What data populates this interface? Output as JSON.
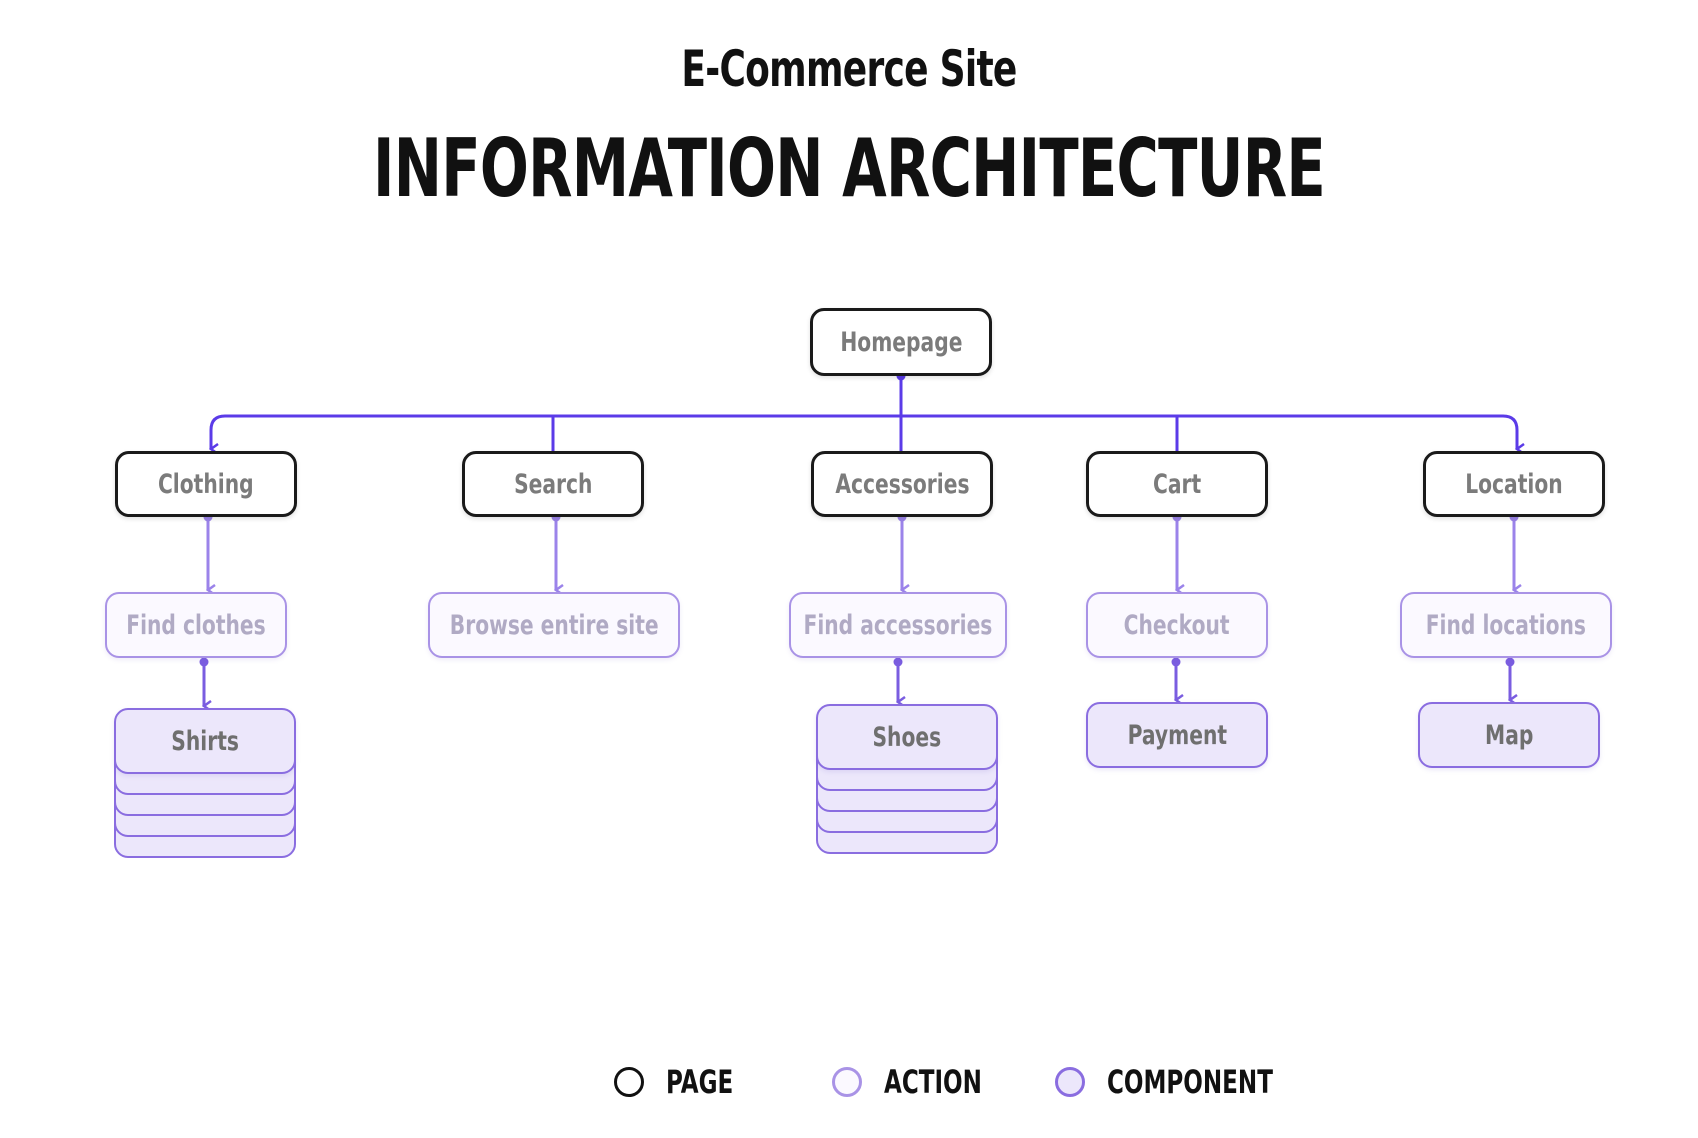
{
  "header": {
    "subtitle": "E-Commerce Site",
    "title": "INFORMATION ARCHITECTURE"
  },
  "colors": {
    "page_border": "#1a1a1a",
    "action_border": "#a993e6",
    "action_fill": "#fbf9ff",
    "component_border": "#8a6de0",
    "component_fill": "#ece7fb",
    "connector_main": "#5b3be8",
    "connector_child": "#9b83ea"
  },
  "root": {
    "label": "Homepage",
    "type": "page"
  },
  "branches": [
    {
      "page": "Clothing",
      "action": "Find clothes",
      "component": "Shirts",
      "component_stacked": true
    },
    {
      "page": "Search",
      "action": "Browse entire site",
      "component": null,
      "component_stacked": false
    },
    {
      "page": "Accessories",
      "action": "Find accessories",
      "component": "Shoes",
      "component_stacked": true
    },
    {
      "page": "Cart",
      "action": "Checkout",
      "component": "Payment",
      "component_stacked": false
    },
    {
      "page": "Location",
      "action": "Find locations",
      "component": "Map",
      "component_stacked": false
    }
  ],
  "legend": [
    {
      "type": "page",
      "label": "PAGE"
    },
    {
      "type": "action",
      "label": "ACTION"
    },
    {
      "type": "component",
      "label": "COMPONENT"
    }
  ]
}
